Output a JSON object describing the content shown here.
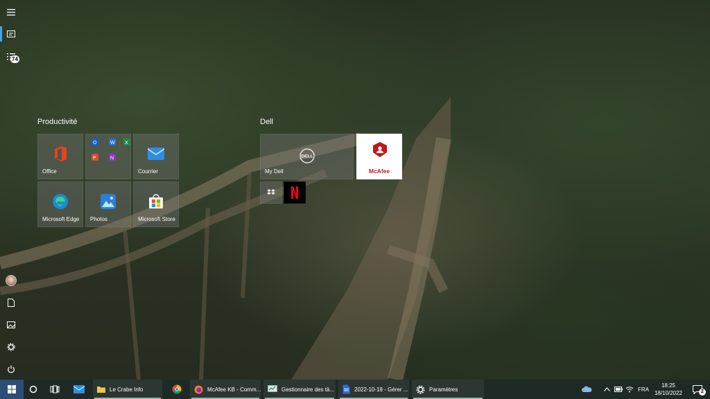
{
  "rail": {
    "notifications_badge": "74"
  },
  "groups": {
    "productivity": {
      "title": "Productivité",
      "tiles": {
        "office": "Office",
        "mail": "Courrier",
        "edge": "Microsoft Edge",
        "photos": "Photos",
        "store": "Microsoft Store"
      }
    },
    "dell": {
      "title": "Dell",
      "tiles": {
        "mydell": "My Dell",
        "mcafee": "McAfee",
        "dell_logo": "DELL"
      }
    }
  },
  "taskbar": {
    "apps": {
      "explorer": "Le Crabe Info",
      "firefox": "McAfee KB - Comm...",
      "taskmgr": "Gestionnaire des tâ...",
      "doc": "2022-10-18 - Gérer ...",
      "settings": "Paramètres"
    },
    "tray": {
      "language": "FRA",
      "time": "18:25",
      "date": "18/10/2022",
      "notif_count": "2"
    }
  },
  "colors": {
    "accent": "#4aa3df",
    "taskbar": "#1f2a27",
    "tile_bg": "rgba(120,120,120,0.38)",
    "mcafee_red": "#c01818",
    "netflix_red": "#e50914"
  }
}
